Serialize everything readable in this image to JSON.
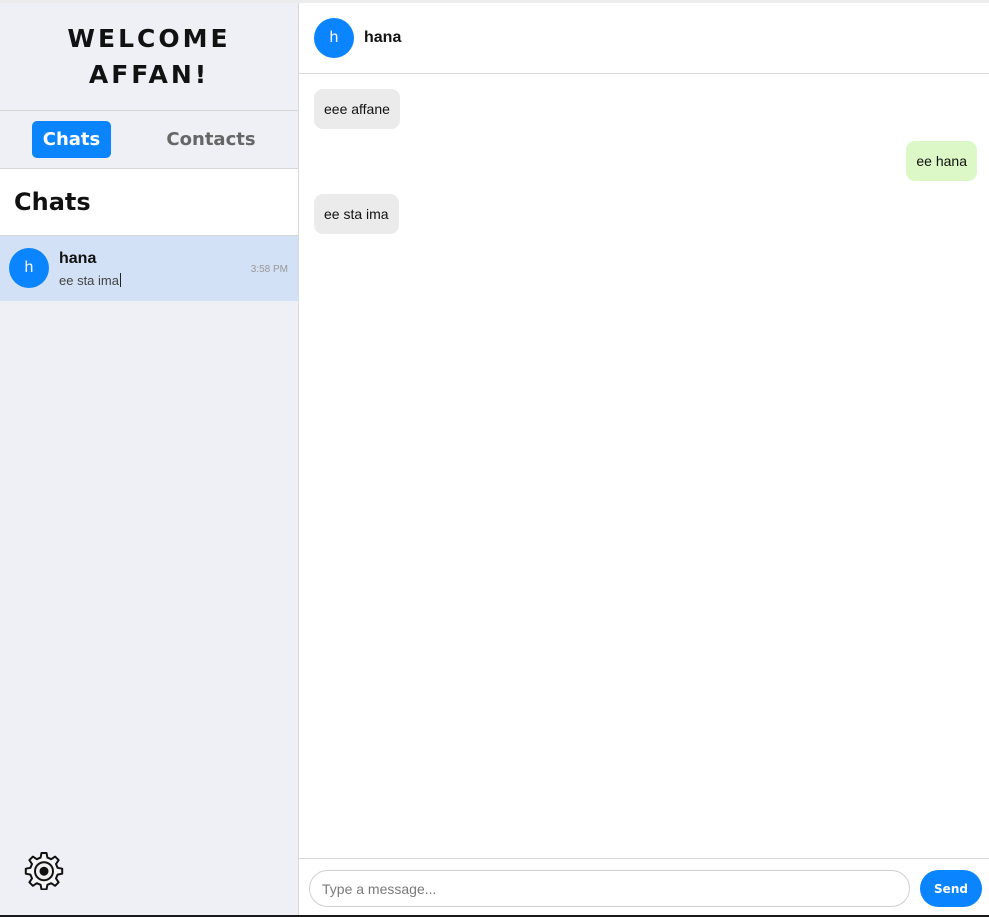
{
  "sidebar": {
    "welcome": "WELCOME AFFAN!",
    "tabs": [
      {
        "label": "Chats",
        "active": true
      },
      {
        "label": "Contacts",
        "active": false
      }
    ],
    "heading": "Chats",
    "conversations": [
      {
        "avatar": "h",
        "name": "hana",
        "preview": "ee sta ima",
        "time": "3:58 PM"
      }
    ],
    "settings_icon": "gear-icon"
  },
  "chat": {
    "header": {
      "avatar": "h",
      "name": "hana"
    },
    "messages": [
      {
        "text": "eee affane",
        "direction": "incoming"
      },
      {
        "text": "ee hana",
        "direction": "outgoing"
      },
      {
        "text": "ee sta ima",
        "direction": "incoming"
      }
    ],
    "composer": {
      "placeholder": "Type a message...",
      "value": "",
      "send_label": "Send"
    }
  },
  "colors": {
    "accent": "#0b84ff",
    "sidebar_bg": "#eef0f5",
    "selected_conversation_bg": "#d2e1f5",
    "incoming_bubble": "#ebebeb",
    "outgoing_bubble": "#dcf8c6"
  }
}
